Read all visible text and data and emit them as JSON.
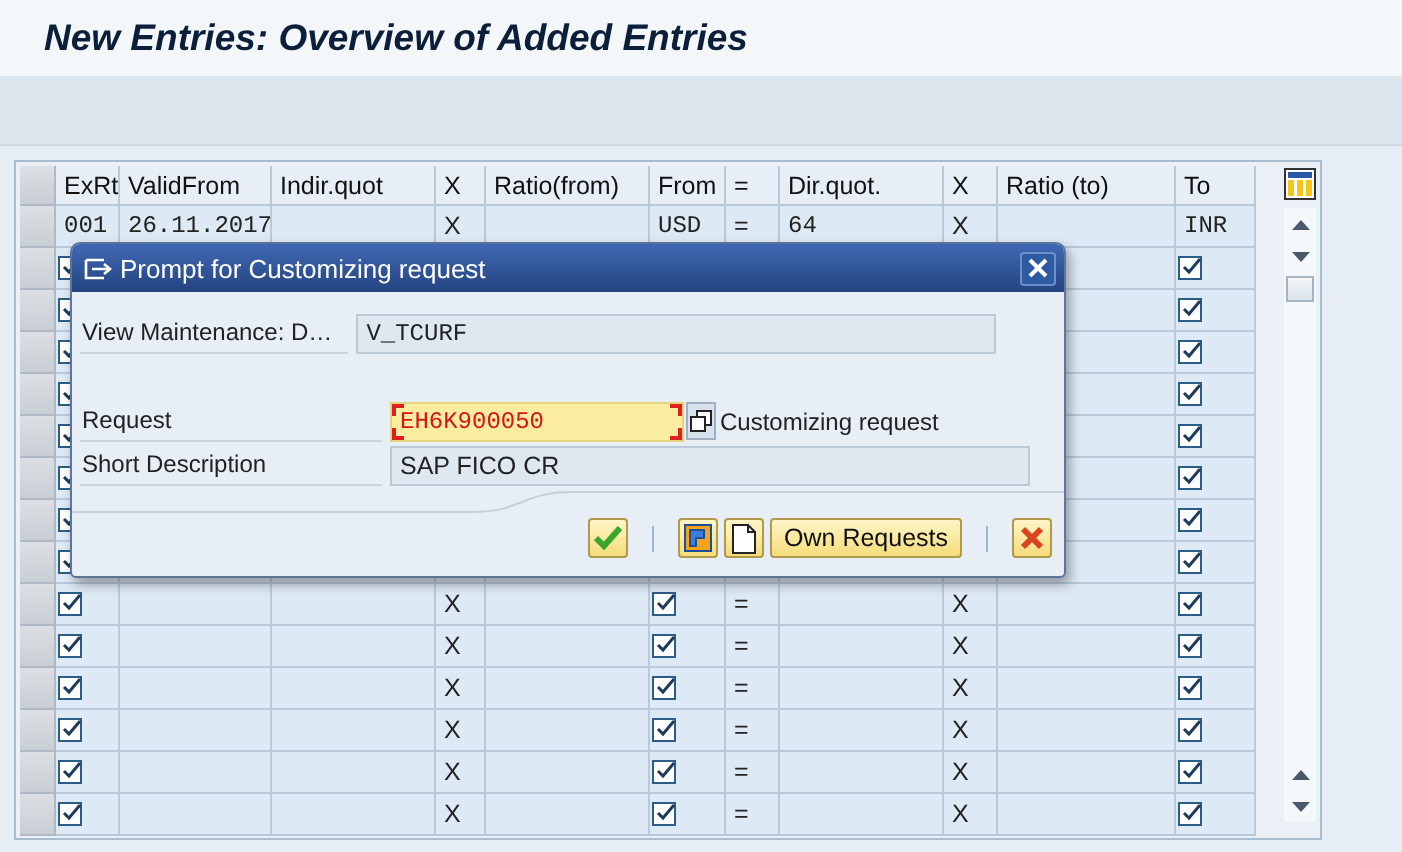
{
  "window": {
    "title": "New Entries: Overview of Added Entries"
  },
  "table": {
    "columns": [
      "ExRt",
      "ValidFrom",
      "Indir.quot",
      "X",
      "Ratio(from)",
      "From",
      "=",
      "Dir.quot.",
      "X",
      "Ratio (to)",
      "To"
    ],
    "rows": [
      {
        "cells": [
          {
            "kind": "code",
            "text": "001"
          },
          {
            "kind": "code",
            "text": "26.11.2017"
          },
          null,
          {
            "kind": "text",
            "text": "X"
          },
          null,
          {
            "kind": "code",
            "text": "USD"
          },
          {
            "kind": "text",
            "text": "="
          },
          {
            "kind": "code",
            "text": "64"
          },
          {
            "kind": "text",
            "text": "X"
          },
          null,
          {
            "kind": "code",
            "text": "INR"
          }
        ]
      },
      {
        "cells": [
          {
            "kind": "checkbox",
            "checked": true
          },
          null,
          null,
          null,
          null,
          null,
          null,
          null,
          null,
          null,
          {
            "kind": "checkbox",
            "checked": true
          }
        ]
      },
      {
        "cells": [
          {
            "kind": "checkbox",
            "checked": true
          },
          null,
          null,
          null,
          null,
          null,
          null,
          null,
          null,
          null,
          {
            "kind": "checkbox",
            "checked": true
          }
        ]
      },
      {
        "cells": [
          {
            "kind": "checkbox",
            "checked": true
          },
          null,
          null,
          null,
          null,
          null,
          null,
          null,
          null,
          null,
          {
            "kind": "checkbox",
            "checked": true
          }
        ]
      },
      {
        "cells": [
          {
            "kind": "checkbox",
            "checked": true
          },
          null,
          null,
          null,
          null,
          null,
          null,
          null,
          null,
          null,
          {
            "kind": "checkbox",
            "checked": true
          }
        ]
      },
      {
        "cells": [
          {
            "kind": "checkbox",
            "checked": true
          },
          null,
          null,
          null,
          null,
          null,
          null,
          null,
          null,
          null,
          {
            "kind": "checkbox",
            "checked": true
          }
        ]
      },
      {
        "cells": [
          {
            "kind": "checkbox",
            "checked": true
          },
          null,
          null,
          null,
          null,
          null,
          null,
          null,
          null,
          null,
          {
            "kind": "checkbox",
            "checked": true
          }
        ]
      },
      {
        "cells": [
          {
            "kind": "checkbox",
            "checked": true
          },
          null,
          null,
          null,
          null,
          null,
          null,
          null,
          null,
          null,
          {
            "kind": "checkbox",
            "checked": true
          }
        ]
      },
      {
        "cells": [
          {
            "kind": "checkbox",
            "checked": true
          },
          null,
          null,
          null,
          null,
          null,
          null,
          null,
          null,
          null,
          {
            "kind": "checkbox",
            "checked": true
          }
        ]
      },
      {
        "cells": [
          {
            "kind": "checkbox",
            "checked": true
          },
          null,
          null,
          {
            "kind": "text",
            "text": "X"
          },
          null,
          {
            "kind": "checkbox",
            "checked": true
          },
          {
            "kind": "text",
            "text": "="
          },
          null,
          {
            "kind": "text",
            "text": "X"
          },
          null,
          {
            "kind": "checkbox",
            "checked": true
          }
        ]
      },
      {
        "cells": [
          {
            "kind": "checkbox",
            "checked": true
          },
          null,
          null,
          {
            "kind": "text",
            "text": "X"
          },
          null,
          {
            "kind": "checkbox",
            "checked": true
          },
          {
            "kind": "text",
            "text": "="
          },
          null,
          {
            "kind": "text",
            "text": "X"
          },
          null,
          {
            "kind": "checkbox",
            "checked": true
          }
        ]
      },
      {
        "cells": [
          {
            "kind": "checkbox",
            "checked": true
          },
          null,
          null,
          {
            "kind": "text",
            "text": "X"
          },
          null,
          {
            "kind": "checkbox",
            "checked": true
          },
          {
            "kind": "text",
            "text": "="
          },
          null,
          {
            "kind": "text",
            "text": "X"
          },
          null,
          {
            "kind": "checkbox",
            "checked": true
          }
        ]
      },
      {
        "cells": [
          {
            "kind": "checkbox",
            "checked": true
          },
          null,
          null,
          {
            "kind": "text",
            "text": "X"
          },
          null,
          {
            "kind": "checkbox",
            "checked": true
          },
          {
            "kind": "text",
            "text": "="
          },
          null,
          {
            "kind": "text",
            "text": "X"
          },
          null,
          {
            "kind": "checkbox",
            "checked": true
          }
        ]
      },
      {
        "cells": [
          {
            "kind": "checkbox",
            "checked": true
          },
          null,
          null,
          {
            "kind": "text",
            "text": "X"
          },
          null,
          {
            "kind": "checkbox",
            "checked": true
          },
          {
            "kind": "text",
            "text": "="
          },
          null,
          {
            "kind": "text",
            "text": "X"
          },
          null,
          {
            "kind": "checkbox",
            "checked": true
          }
        ]
      },
      {
        "cells": [
          {
            "kind": "checkbox",
            "checked": true
          },
          null,
          null,
          {
            "kind": "text",
            "text": "X"
          },
          null,
          {
            "kind": "checkbox",
            "checked": true
          },
          {
            "kind": "text",
            "text": "="
          },
          null,
          {
            "kind": "text",
            "text": "X"
          },
          null,
          {
            "kind": "checkbox",
            "checked": true
          }
        ]
      }
    ]
  },
  "dialog": {
    "title": "Prompt for Customizing request",
    "fields": [
      {
        "label": "View Maintenance: D…",
        "value": "V_TCURF",
        "kind": "display"
      },
      {
        "label": "Request",
        "value": "EH6K900050",
        "kind": "required",
        "hint": "Customizing request"
      },
      {
        "label": "Short Description",
        "value": "SAP FICO CR",
        "kind": "display"
      }
    ],
    "buttons": [
      {
        "kind": "confirm"
      },
      {
        "kind": "separator"
      },
      {
        "kind": "transport"
      },
      {
        "kind": "new"
      },
      {
        "kind": "text",
        "label": "Own Requests"
      },
      {
        "kind": "separator"
      },
      {
        "kind": "cancel"
      }
    ]
  }
}
